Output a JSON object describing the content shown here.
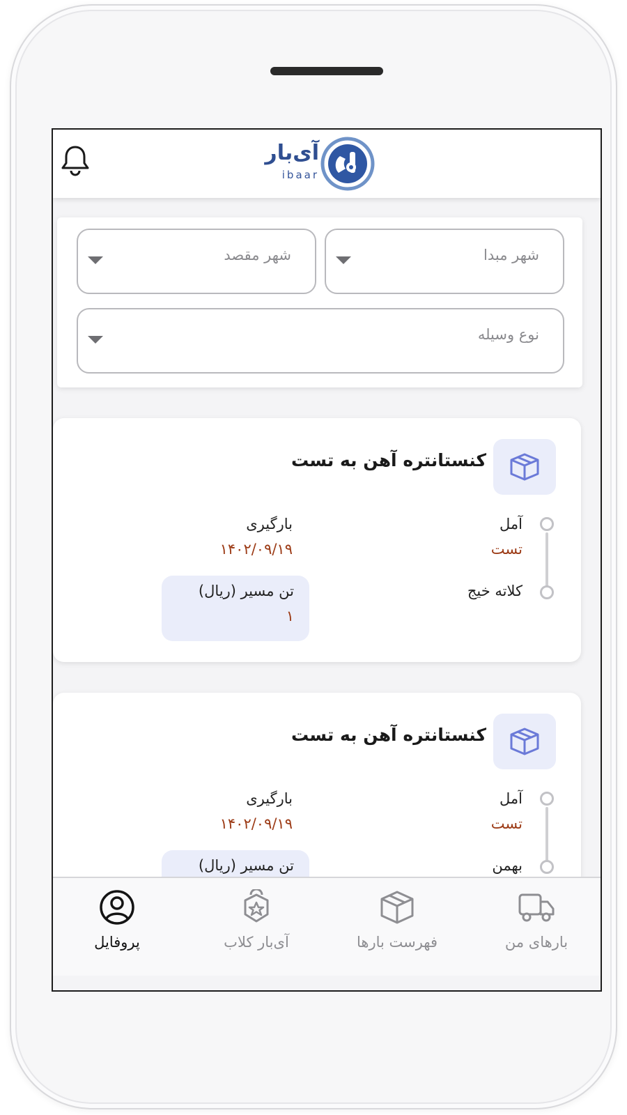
{
  "header": {
    "logo_fa": "آی‌بار",
    "logo_en": "ibaar"
  },
  "filters": {
    "origin_placeholder": "شهر مبدا",
    "destination_placeholder": "شهر مقصد",
    "vehicle_placeholder": "نوع وسیله"
  },
  "cards": [
    {
      "title": "کنستانتره آهن  به تست",
      "origin_city": "آمل",
      "origin_sub": "تست",
      "destination_city": "کلاته خیج",
      "load_label": "بارگیری",
      "load_date": "۱۴۰۲/۰۹/۱۹",
      "price_label": "تن مسیر (ریال)",
      "price_value": "۱"
    },
    {
      "title": "کنستانتره آهن  به تست",
      "origin_city": "آمل",
      "origin_sub": "تست",
      "destination_city": "بهمن",
      "load_label": "بارگیری",
      "load_date": "۱۴۰۲/۰۹/۱۹",
      "price_label": "تن مسیر (ریال)",
      "price_value": ""
    }
  ],
  "bottom_nav": {
    "items": [
      {
        "label": "بارهای من",
        "icon": "truck-icon",
        "active": false
      },
      {
        "label": "فهرست بارها",
        "icon": "box-icon",
        "active": false
      },
      {
        "label": "آی‌بار کلاب",
        "icon": "club-badge-icon",
        "active": false
      },
      {
        "label": "پروفایل",
        "icon": "profile-icon",
        "active": true
      }
    ]
  },
  "colors": {
    "accent_brand": "#2f4e91",
    "accent_highlight": "#9c3b16",
    "chip_bg": "#eaedfa",
    "icon_blue": "#6b7ad8"
  }
}
